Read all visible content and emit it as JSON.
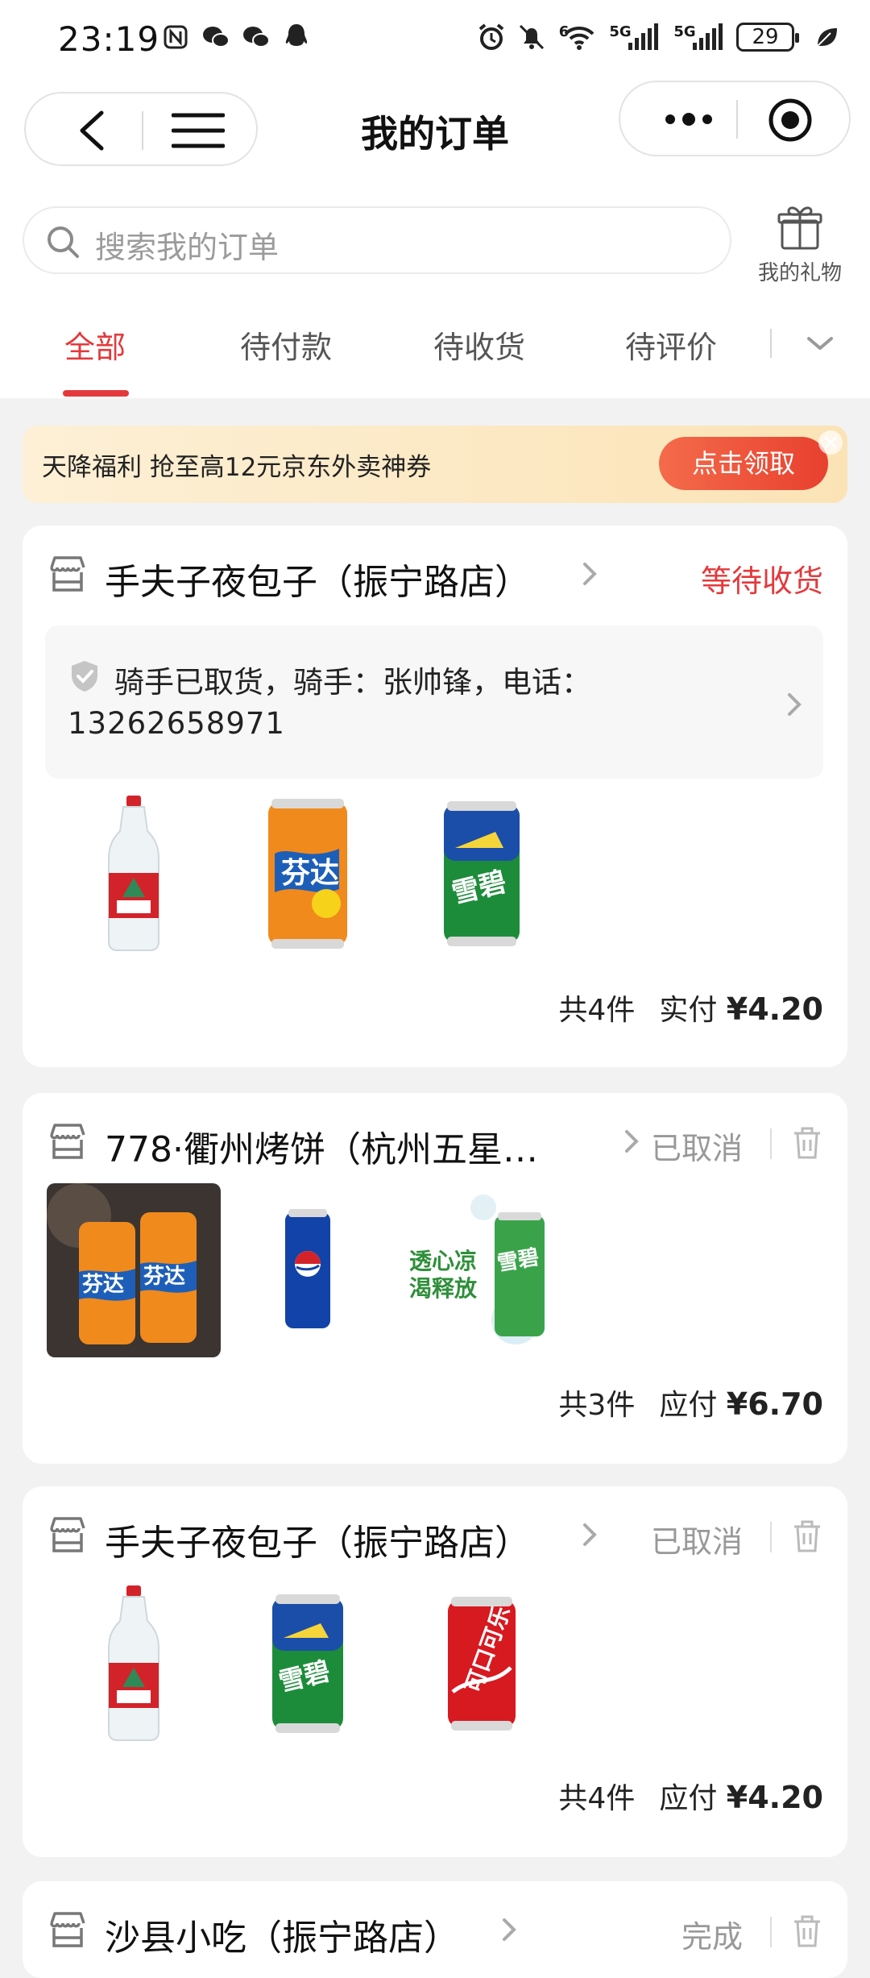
{
  "status_bar": {
    "time": "23:19",
    "battery": "29",
    "network_1": "5G",
    "network_2": "5G",
    "wifi_label": "6"
  },
  "header": {
    "title": "我的订单"
  },
  "search": {
    "placeholder": "搜索我的订单",
    "gift_label": "我的礼物"
  },
  "tabs": [
    "全部",
    "待付款",
    "待收货",
    "待评价"
  ],
  "banner": {
    "text": "天降福利 抢至高12元京东外卖神券",
    "button": "点击领取"
  },
  "orders": [
    {
      "shop": "手夫子夜包子（振宁路店）",
      "status": "等待收货",
      "rider_line1": "骑手已取货，骑手：张帅锋，电话：",
      "rider_line2": "13262658971",
      "items": [
        "农夫山泉",
        "芬达",
        "雪碧"
      ],
      "count": "共4件",
      "pay_label": "实付",
      "price": "¥4.20"
    },
    {
      "shop": "778·衢州烤饼（杭州五星…",
      "status": "已取消",
      "items": [
        "芬达",
        "百事可乐",
        "雪碧"
      ],
      "ad_text_1": "透心凉",
      "ad_text_2": "渴释放",
      "count": "共3件",
      "pay_label": "应付",
      "price": "¥6.70"
    },
    {
      "shop": "手夫子夜包子（振宁路店）",
      "status": "已取消",
      "items": [
        "农夫山泉",
        "雪碧",
        "可口可乐"
      ],
      "count": "共4件",
      "pay_label": "应付",
      "price": "¥4.20"
    },
    {
      "shop": "沙县小吃（振宁路店）",
      "status": "完成"
    }
  ],
  "colors": {
    "accent": "#e4393c",
    "banner_bg": "#fbe3b6",
    "page_bg": "#f2f2f2"
  }
}
